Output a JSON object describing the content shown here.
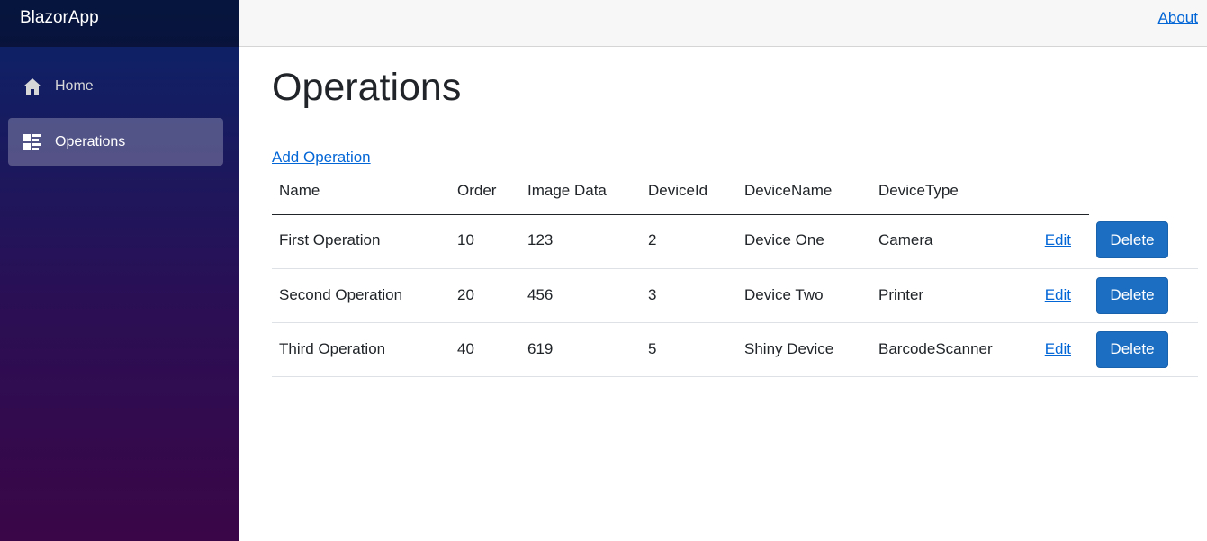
{
  "sidebar": {
    "brand": "BlazorApp",
    "items": [
      {
        "label": "Home",
        "icon": "home-icon",
        "active": false
      },
      {
        "label": "Operations",
        "icon": "list-rich-icon",
        "active": true
      }
    ]
  },
  "topbar": {
    "about_label": "About"
  },
  "main": {
    "title": "Operations",
    "add_label": "Add Operation",
    "columns": [
      "Name",
      "Order",
      "Image Data",
      "DeviceId",
      "DeviceName",
      "DeviceType"
    ],
    "rows": [
      {
        "name": "First Operation",
        "order": "10",
        "image_data": "123",
        "device_id": "2",
        "device_name": "Device One",
        "device_type": "Camera",
        "edit": "Edit",
        "delete": "Delete"
      },
      {
        "name": "Second Operation",
        "order": "20",
        "image_data": "456",
        "device_id": "3",
        "device_name": "Device Two",
        "device_type": "Printer",
        "edit": "Edit",
        "delete": "Delete"
      },
      {
        "name": "Third Operation",
        "order": "40",
        "image_data": "619",
        "device_id": "5",
        "device_name": "Shiny Device",
        "device_type": "BarcodeScanner",
        "edit": "Edit",
        "delete": "Delete"
      }
    ]
  },
  "colors": {
    "accent": "#1b6ec2",
    "link": "#0366d6"
  }
}
